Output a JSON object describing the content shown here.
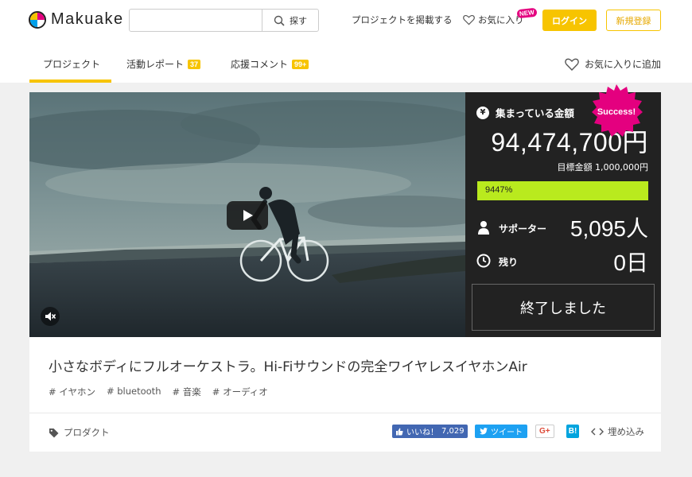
{
  "header": {
    "logo_text": "Makuake",
    "search": {
      "placeholder": "",
      "button_label": "探す"
    },
    "post_project": "プロジェクトを掲載する",
    "favorites": "お気に入り",
    "new_badge": "NEW",
    "login": "ログイン",
    "register": "新規登録"
  },
  "tabs": [
    {
      "label": "プロジェクト",
      "badge": ""
    },
    {
      "label": "活動レポート",
      "badge": "37"
    },
    {
      "label": "応援コメント",
      "badge": "99+"
    }
  ],
  "add_favorite": "お気に入りに追加",
  "funding": {
    "collected_label": "集まっている金額",
    "amount": "94,474,700円",
    "goal": "目標金額 1,000,000円",
    "progress_percent": 9447,
    "progress_text": "9447%",
    "supporters_label": "サポーター",
    "supporters": "5,095人",
    "remaining_label": "残り",
    "remaining": "0日",
    "ended_button": "終了しました",
    "success_badge": "Success!"
  },
  "project": {
    "title": "小さなボディにフルオーケストラ。Hi-Fiサウンドの完全ワイヤレスイヤホンAir",
    "tags": [
      "# イヤホン",
      "# bluetooth",
      "# 音楽",
      "# オーディオ"
    ],
    "category": "プロダクト"
  },
  "share": {
    "like_label": "いいね！",
    "like_count": "7,029",
    "tweet_label": "ツイート",
    "gplus_label": "G+",
    "hatena_label": "B!",
    "embed_label": "埋め込み"
  },
  "colors": {
    "accent": "#f7c400",
    "progress": "#b9ea1e",
    "panel": "#222222",
    "success": "#e4007f"
  }
}
